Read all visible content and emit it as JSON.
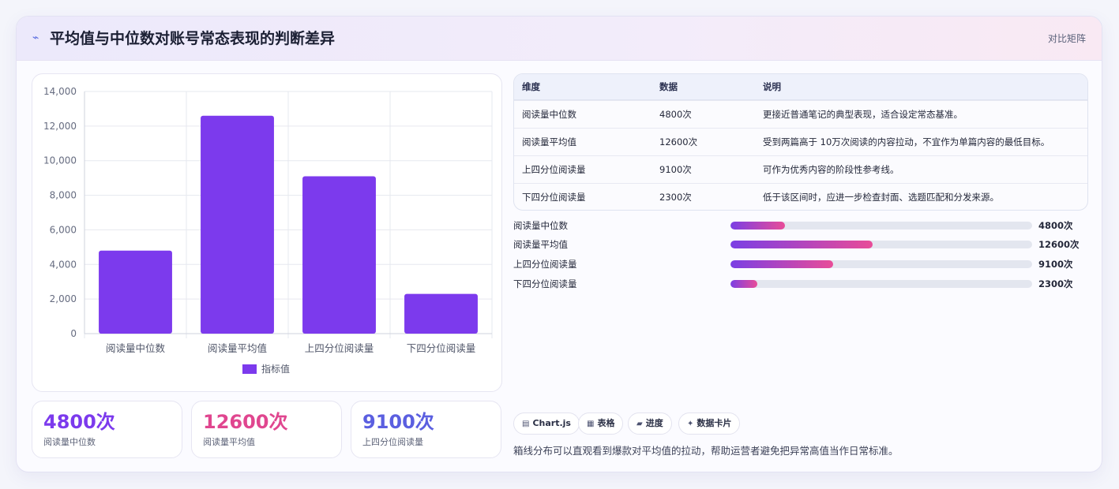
{
  "header": {
    "title": "平均值与中位数对账号常态表现的判断差异",
    "mode_label": "对比矩阵"
  },
  "chart_data": {
    "type": "bar",
    "categories": [
      "阅读量中位数",
      "阅读量平均值",
      "上四分位阅读量",
      "下四分位阅读量"
    ],
    "series": [
      {
        "name": "指标值",
        "values": [
          4800,
          12600,
          9100,
          2300
        ]
      }
    ],
    "ylim": [
      0,
      14000
    ],
    "yticks": [
      "0",
      "2,000",
      "4,000",
      "6,000",
      "8,000",
      "10,000",
      "12,000",
      "14,000"
    ],
    "ytick_values": [
      0,
      2000,
      4000,
      6000,
      8000,
      10000,
      12000,
      14000
    ],
    "grid": true,
    "legend": "bottom",
    "bar_color": "#7c3aed"
  },
  "stats": [
    {
      "value": "4800次",
      "label": "阅读量中位数",
      "color": "#7c3aed"
    },
    {
      "value": "12600次",
      "label": "阅读量平均值",
      "color": "#e0468f"
    },
    {
      "value": "9100次",
      "label": "上四分位阅读量",
      "color": "#5b5fe0"
    }
  ],
  "table": {
    "headers": [
      "维度",
      "数据",
      "说明"
    ],
    "rows": [
      {
        "dim": "阅读量中位数",
        "data": "4800次",
        "desc": "更接近普通笔记的典型表现，适合设定常态基准。"
      },
      {
        "dim": "阅读量平均值",
        "data": "12600次",
        "desc": "受到两篇高于 10万次阅读的内容拉动，不宜作为单篇内容的最低目标。"
      },
      {
        "dim": "上四分位阅读量",
        "data": "9100次",
        "desc": "可作为优秀内容的阶段性参考线。"
      },
      {
        "dim": "下四分位阅读量",
        "data": "2300次",
        "desc": "低于该区间时，应进一步检查封面、选题匹配和分发来源。"
      }
    ]
  },
  "progress": [
    {
      "label": "阅读量中位数",
      "value_text": "4800次",
      "fraction": 0.18
    },
    {
      "label": "阅读量平均值",
      "value_text": "12600次",
      "fraction": 0.47
    },
    {
      "label": "上四分位阅读量",
      "value_text": "9100次",
      "fraction": 0.34
    },
    {
      "label": "下四分位阅读量",
      "value_text": "2300次",
      "fraction": 0.09
    }
  ],
  "chips": [
    {
      "icon": "chart-icon",
      "glyph": "▤",
      "label": "Chart.js"
    },
    {
      "icon": "table-icon",
      "glyph": "▦",
      "label": "表格"
    },
    {
      "icon": "progress-icon",
      "glyph": "▰",
      "label": "进度"
    },
    {
      "icon": "sparkle-icon",
      "glyph": "✦",
      "label": "数据卡片"
    }
  ],
  "note": "箱线分布可以直观看到爆款对平均值的拉动，帮助运营者避免把异常高值当作日常标准。"
}
